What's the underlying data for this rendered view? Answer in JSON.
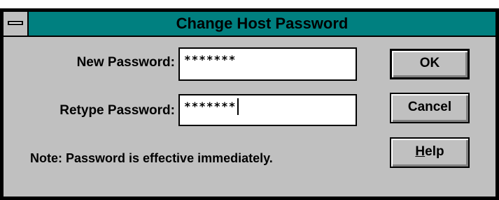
{
  "dialog": {
    "title": "Change Host Password"
  },
  "fields": {
    "new_password": {
      "label": "New Password:",
      "value": "*******"
    },
    "retype_password": {
      "label": "Retype Password:",
      "value": "*******"
    }
  },
  "buttons": {
    "ok": "OK",
    "cancel": "Cancel",
    "help_mnemonic": "H",
    "help_rest": "elp"
  },
  "note": "Note:  Password is effective immediately.",
  "colors": {
    "titlebar": "#008080",
    "dialog_face": "#c0c0c0"
  },
  "icons": {
    "system_menu": "system-menu-icon"
  }
}
